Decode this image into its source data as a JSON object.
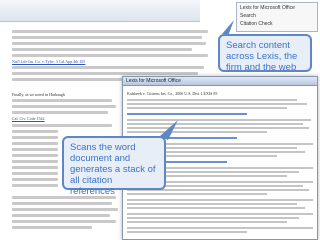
{
  "callouts": {
    "search_tip": "Search content across Lexis, the firm and the web",
    "scan_tip": "Scans the word document and generates a stack of all citation references"
  },
  "document": {
    "cite_snippet_1": "Nat'l Life Ins. Co. v. Tyler, 3 Cal.App.4th 105",
    "cite_snippet_2": "Cal. Civ. Code 1542",
    "paragraph_lead": "Finally, as we noted in Harbaugh"
  },
  "popup": {
    "title": "Lexis for Microsoft Office",
    "heading": "Kalsbeek v. Citizens Ins. Co., 2006 U.S. Dist. LEXIS 85"
  },
  "panel": {
    "rows": [
      "Lexis for Microsoft Office",
      "Search",
      "Citation Check"
    ]
  }
}
